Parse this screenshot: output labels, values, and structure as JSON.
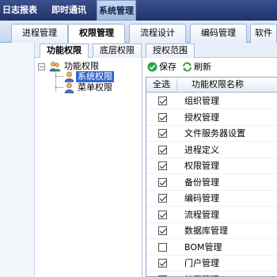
{
  "top_nav": {
    "items": [
      {
        "label": "日志报表",
        "active": false
      },
      {
        "label": "即时通讯",
        "active": false
      },
      {
        "label": "系统管理",
        "active": true
      }
    ]
  },
  "module_tabs": [
    {
      "label": "进程管理",
      "active": false
    },
    {
      "label": "权限管理",
      "active": true
    },
    {
      "label": "流程设计",
      "active": false
    },
    {
      "label": "编码管理",
      "active": false
    },
    {
      "label": "软件",
      "active": false
    }
  ],
  "sub_tabs": [
    {
      "label": "功能权限",
      "active": true
    },
    {
      "label": "底层权限",
      "active": false
    },
    {
      "label": "授权范围",
      "active": false
    }
  ],
  "tree": {
    "root": {
      "label": "功能权限",
      "expanded": true,
      "toggle": "−"
    },
    "children": [
      {
        "label": "系统权限",
        "selected": true
      },
      {
        "label": "菜单权限",
        "selected": false
      }
    ]
  },
  "toolbar": {
    "save_label": "保存",
    "refresh_label": "刷新"
  },
  "grid": {
    "headers": {
      "select_all": "全选",
      "name": "功能权限名称"
    },
    "rows": [
      {
        "name": "组织管理",
        "checked": true
      },
      {
        "name": "授权管理",
        "checked": true
      },
      {
        "name": "文件服务器设置",
        "checked": true
      },
      {
        "name": "进程定义",
        "checked": true
      },
      {
        "name": "权限管理",
        "checked": true
      },
      {
        "name": "备份管理",
        "checked": true
      },
      {
        "name": "编码管理",
        "checked": true
      },
      {
        "name": "流程管理",
        "checked": true
      },
      {
        "name": "数据库管理",
        "checked": true
      },
      {
        "name": "BOM管理",
        "checked": false
      },
      {
        "name": "门户管理",
        "checked": true
      },
      {
        "name": "档案管理",
        "checked": false
      }
    ]
  },
  "colors": {
    "nav_bg": "#2c3e74",
    "selected_bg": "#3366cc",
    "accent_save": "#2aa34a",
    "accent_refresh": "#3a9a3a"
  }
}
